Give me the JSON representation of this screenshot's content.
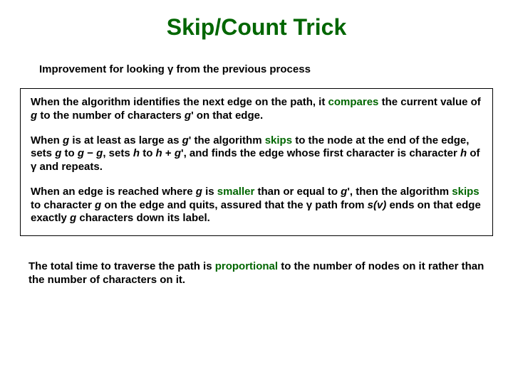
{
  "title": "Skip/Count Trick",
  "subtitle_a": "Improvement for looking ",
  "subtitle_g": "γ",
  "subtitle_b": " from the previous process",
  "p1_a": "When the algorithm identifies the next edge on the path, it ",
  "p1_kw1": "compares",
  "p1_b": " the current value of ",
  "p1_g": "g",
  "p1_c": " to the number of characters ",
  "p1_gp": "g",
  "p1_prime1": "'",
  "p1_d": " on that edge.",
  "p2_a": "When ",
  "p2_g1": "g",
  "p2_b": " is at least as large as ",
  "p2_gp": "g",
  "p2_prime1": "'",
  "p2_c": " the algorithm ",
  "p2_kw1": "skips",
  "p2_d": " to the node at the end of the edge, sets ",
  "p2_g2": "g",
  "p2_e": " to ",
  "p2_g3": "g",
  "p2_f": " − ",
  "p2_g4": "g",
  "p2_g": ", sets ",
  "p2_h1": "h",
  "p2_h": " to ",
  "p2_h2": "h",
  "p2_i": " + ",
  "p2_gp2": "g",
  "p2_prime2": "'",
  "p2_j": ", and finds the edge whose first character is character ",
  "p2_h3": "h",
  "p2_k": " of ",
  "p2_gamma": "γ",
  "p2_l": " and repeats.",
  "p3_a": "When an edge is reached where ",
  "p3_g1": "g",
  "p3_b": " is ",
  "p3_kw1": "smaller",
  "p3_c": " than or equal to ",
  "p3_gp": "g",
  "p3_prime1": "'",
  "p3_d": ", then the algorithm ",
  "p3_kw2": "skips",
  "p3_e": " to character ",
  "p3_g2": "g",
  "p3_f": " on the edge and quits, assured that the ",
  "p3_gamma": "γ",
  "p3_g": " path from ",
  "p3_sv": "s(v)",
  "p3_h": " ends on that edge exactly ",
  "p3_g3": "g",
  "p3_i": " characters down its label.",
  "f_a": "The total time to traverse the path is ",
  "f_kw": "proportional",
  "f_b": " to the number of nodes on it rather than the number of characters on it."
}
